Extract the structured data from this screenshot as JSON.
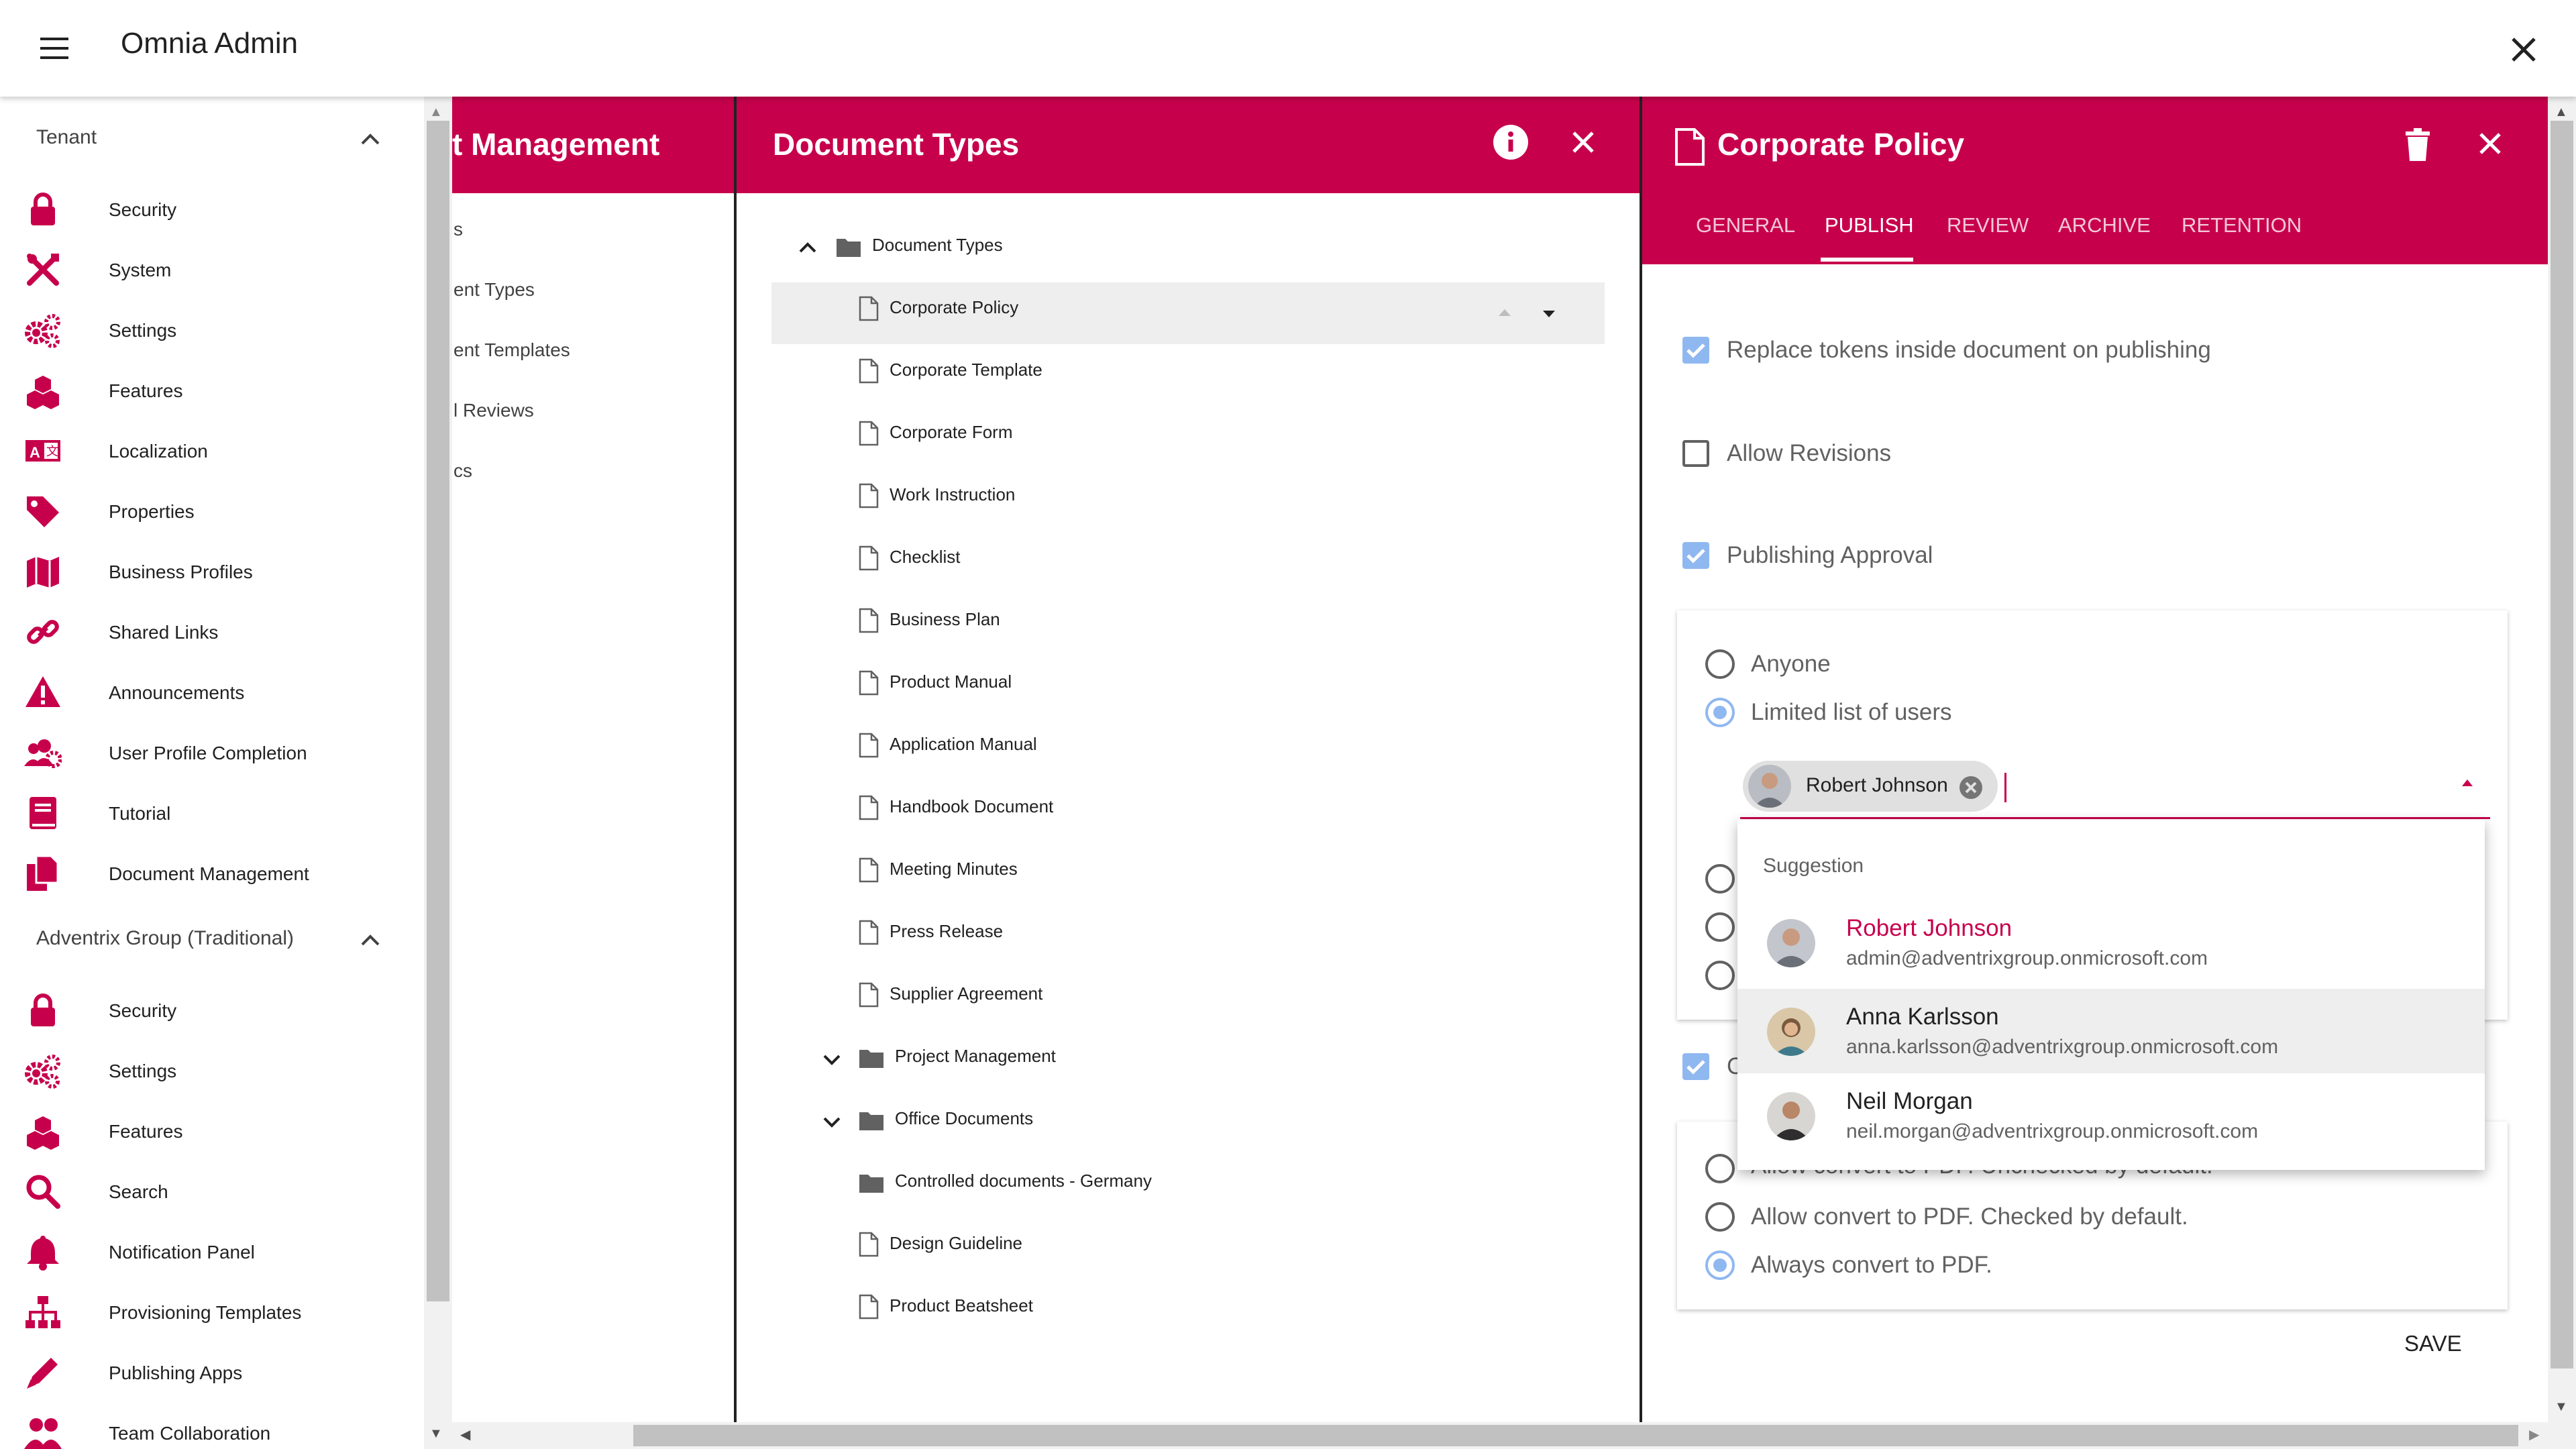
{
  "app": {
    "title": "Omnia Admin"
  },
  "sidebar": {
    "sections": [
      {
        "title": "Tenant",
        "items": [
          {
            "label": "Security",
            "icon": "lock-icon"
          },
          {
            "label": "System",
            "icon": "tools-icon"
          },
          {
            "label": "Settings",
            "icon": "gears-icon"
          },
          {
            "label": "Features",
            "icon": "cubes-icon"
          },
          {
            "label": "Localization",
            "icon": "language-icon"
          },
          {
            "label": "Properties",
            "icon": "tag-icon"
          },
          {
            "label": "Business Profiles",
            "icon": "map-icon"
          },
          {
            "label": "Shared Links",
            "icon": "link-icon"
          },
          {
            "label": "Announcements",
            "icon": "warning-icon"
          },
          {
            "label": "User Profile Completion",
            "icon": "users-icon"
          },
          {
            "label": "Tutorial",
            "icon": "book-icon"
          },
          {
            "label": "Document Management",
            "icon": "copy-icon"
          }
        ]
      },
      {
        "title": "Adventrix Group (Traditional)",
        "items": [
          {
            "label": "Security",
            "icon": "lock-icon"
          },
          {
            "label": "Settings",
            "icon": "gears-icon"
          },
          {
            "label": "Features",
            "icon": "cubes-icon"
          },
          {
            "label": "Search",
            "icon": "search-icon"
          },
          {
            "label": "Notification Panel",
            "icon": "bell-icon"
          },
          {
            "label": "Provisioning Templates",
            "icon": "sitemap-icon"
          },
          {
            "label": "Publishing Apps",
            "icon": "pen-icon"
          },
          {
            "label": "Team Collaboration",
            "icon": "team-icon"
          }
        ]
      }
    ]
  },
  "panel1": {
    "title": "t Management",
    "items": [
      "s",
      "ent Types",
      "ent Templates",
      "l Reviews",
      "cs"
    ]
  },
  "panel2": {
    "title": "Document Types",
    "tree": [
      {
        "label": "Document Types",
        "kind": "folder",
        "level": 0,
        "toggle": "up"
      },
      {
        "label": "Corporate Policy",
        "kind": "file",
        "level": 1,
        "selected": true
      },
      {
        "label": "Corporate Template",
        "kind": "file",
        "level": 1
      },
      {
        "label": "Corporate Form",
        "kind": "file",
        "level": 1
      },
      {
        "label": "Work Instruction",
        "kind": "file",
        "level": 1
      },
      {
        "label": "Checklist",
        "kind": "file",
        "level": 1
      },
      {
        "label": "Business Plan",
        "kind": "file",
        "level": 1
      },
      {
        "label": "Product Manual",
        "kind": "file",
        "level": 1
      },
      {
        "label": "Application Manual",
        "kind": "file",
        "level": 1
      },
      {
        "label": "Handbook Document",
        "kind": "file",
        "level": 1
      },
      {
        "label": "Meeting Minutes",
        "kind": "file",
        "level": 1
      },
      {
        "label": "Press Release",
        "kind": "file",
        "level": 1
      },
      {
        "label": "Supplier Agreement",
        "kind": "file",
        "level": 1
      },
      {
        "label": "Project Management",
        "kind": "folder",
        "level": 1,
        "toggle": "down"
      },
      {
        "label": "Office Documents",
        "kind": "folder",
        "level": 1,
        "toggle": "down"
      },
      {
        "label": "Controlled documents - Germany",
        "kind": "folder",
        "level": 1
      },
      {
        "label": "Design Guideline",
        "kind": "file",
        "level": 1
      },
      {
        "label": "Product Beatsheet",
        "kind": "file",
        "level": 1
      }
    ]
  },
  "panel3": {
    "title": "Corporate Policy",
    "tabs": [
      {
        "label": "GENERAL",
        "active": false
      },
      {
        "label": "PUBLISH",
        "active": true
      },
      {
        "label": "REVIEW",
        "active": false
      },
      {
        "label": "ARCHIVE",
        "active": false
      },
      {
        "label": "RETENTION",
        "active": false
      }
    ],
    "options": {
      "replace_tokens": {
        "label": "Replace tokens inside document on publishing",
        "checked": true
      },
      "allow_revisions": {
        "label": "Allow Revisions",
        "checked": false
      },
      "publishing_approval": {
        "label": "Publishing Approval",
        "checked": true
      },
      "convert_checkbox": {
        "label": "C",
        "checked": true
      }
    },
    "approval": {
      "anyone": {
        "label": "Anyone",
        "selected": false
      },
      "limited": {
        "label": "Limited list of users",
        "selected": true
      },
      "chip": {
        "name": "Robert Johnson"
      }
    },
    "suggestions": {
      "header": "Suggestion",
      "items": [
        {
          "name": "Robert Johnson",
          "email": "admin@adventrixgroup.onmicrosoft.com",
          "highlight": true
        },
        {
          "name": "Anna Karlsson",
          "email": "anna.karlsson@adventrixgroup.onmicrosoft.com",
          "hovered": true
        },
        {
          "name": "Neil Morgan",
          "email": "neil.morgan@adventrixgroup.onmicrosoft.com"
        }
      ]
    },
    "pdf": [
      {
        "label": "Allow convert to PDF. Unchecked by default.",
        "selected": false
      },
      {
        "label": "Allow convert to PDF. Checked by default.",
        "selected": false
      },
      {
        "label": "Always convert to PDF.",
        "selected": true
      }
    ],
    "save_label": "SAVE"
  },
  "colors": {
    "brand": "#c7004c",
    "check": "#90b8f0"
  }
}
